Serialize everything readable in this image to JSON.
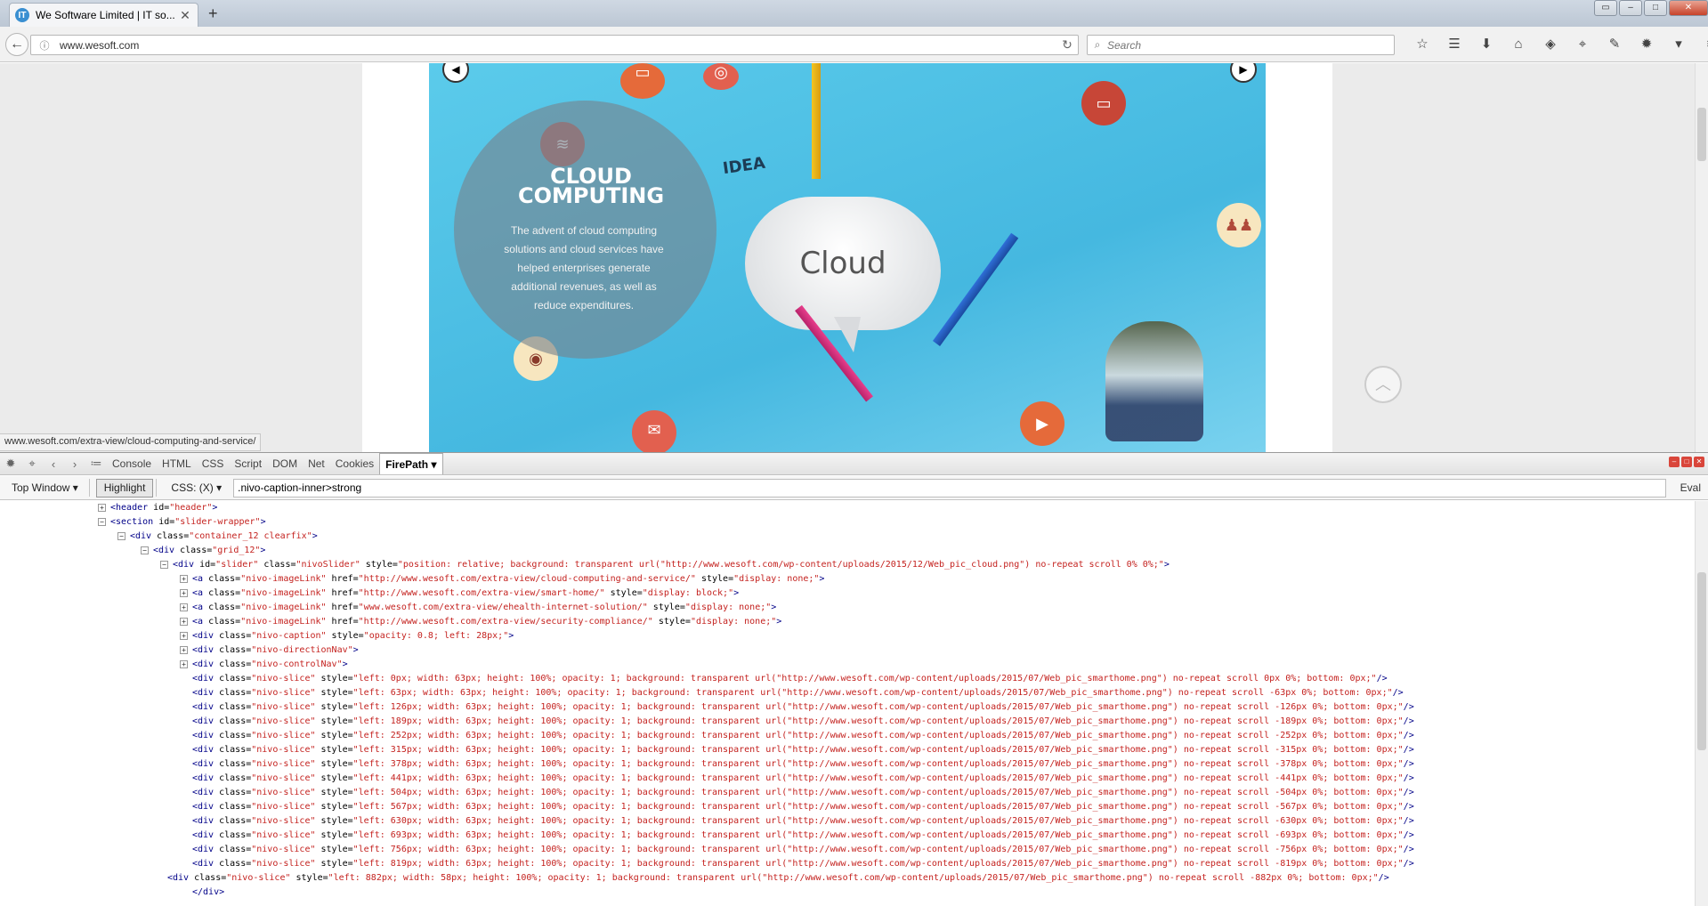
{
  "browser": {
    "tab_title": "We Software Limited | IT so...",
    "tab_favicon": "IT",
    "url": "www.wesoft.com",
    "search_placeholder": "Search",
    "status_url": "www.wesoft.com/extra-view/cloud-computing-and-service/"
  },
  "slide": {
    "caption_title": "CLOUD COMPUTING",
    "caption_text": "The advent of cloud computing solutions and cloud services have helped enterprises generate additional revenues, as well as reduce expenditures.",
    "cloud_word": "Cloud",
    "idea_word": "IDEA",
    "sky_color": "#45b8e0"
  },
  "firebug": {
    "tabs": [
      "Console",
      "HTML",
      "CSS",
      "Script",
      "DOM",
      "Net",
      "Cookies",
      "FirePath ▾"
    ],
    "active_tab": "FirePath",
    "window_select": "Top Window ▾",
    "highlight_label": "Highlight",
    "css_mode": "CSS: (X) ▾",
    "xpath_value": ".nivo-caption-inner>strong",
    "eval_label": "Eval",
    "code_lines": [
      {
        "t": "+",
        "p": [
          [
            "tg",
            "<header "
          ],
          [
            "an",
            "id="
          ],
          [
            "av",
            "\"header\""
          ],
          [
            "tg",
            ">"
          ]
        ]
      },
      {
        "t": "-",
        "p": [
          [
            "tg",
            "<section "
          ],
          [
            "an",
            "id="
          ],
          [
            "av",
            "\"slider-wrapper\""
          ],
          [
            "tg",
            ">"
          ]
        ]
      },
      {
        "t": "-",
        "p": [
          [
            "tg",
            "<div "
          ],
          [
            "an",
            "class="
          ],
          [
            "av",
            "\"container_12 clearfix\""
          ],
          [
            "tg",
            ">"
          ]
        ]
      },
      {
        "t": "-",
        "p": [
          [
            "tg",
            "<div "
          ],
          [
            "an",
            "class="
          ],
          [
            "av",
            "\"grid_12\""
          ],
          [
            "tg",
            ">"
          ]
        ]
      },
      {
        "t": "-",
        "p": [
          [
            "tg",
            "<div "
          ],
          [
            "an",
            "id="
          ],
          [
            "av",
            "\"slider\" "
          ],
          [
            "an",
            "class="
          ],
          [
            "av",
            "\"nivoSlider\" "
          ],
          [
            "an",
            "style="
          ],
          [
            "av",
            "\"position: relative; background: transparent url(\"http://www.wesoft.com/wp-content/uploads/2015/12/Web_pic_cloud.png\") no-repeat scroll 0% 0%;\""
          ],
          [
            "tg",
            ">"
          ]
        ]
      },
      {
        "t": "+",
        "p": [
          [
            "tg",
            "<a "
          ],
          [
            "an",
            "class="
          ],
          [
            "av",
            "\"nivo-imageLink\" "
          ],
          [
            "an",
            "href="
          ],
          [
            "av",
            "\"http://www.wesoft.com/extra-view/cloud-computing-and-service/\" "
          ],
          [
            "an",
            "style="
          ],
          [
            "av",
            "\"display: none;\""
          ],
          [
            "tg",
            ">"
          ]
        ]
      },
      {
        "t": "+",
        "p": [
          [
            "tg",
            "<a "
          ],
          [
            "an",
            "class="
          ],
          [
            "av",
            "\"nivo-imageLink\" "
          ],
          [
            "an",
            "href="
          ],
          [
            "av",
            "\"http://www.wesoft.com/extra-view/smart-home/\" "
          ],
          [
            "an",
            "style="
          ],
          [
            "av",
            "\"display: block;\""
          ],
          [
            "tg",
            ">"
          ]
        ]
      },
      {
        "t": "+",
        "p": [
          [
            "tg",
            "<a "
          ],
          [
            "an",
            "class="
          ],
          [
            "av",
            "\"nivo-imageLink\" "
          ],
          [
            "an",
            "href="
          ],
          [
            "av",
            "\"www.wesoft.com/extra-view/ehealth-internet-solution/\" "
          ],
          [
            "an",
            "style="
          ],
          [
            "av",
            "\"display: none;\""
          ],
          [
            "tg",
            ">"
          ]
        ]
      },
      {
        "t": "+",
        "p": [
          [
            "tg",
            "<a "
          ],
          [
            "an",
            "class="
          ],
          [
            "av",
            "\"nivo-imageLink\" "
          ],
          [
            "an",
            "href="
          ],
          [
            "av",
            "\"http://www.wesoft.com/extra-view/security-compliance/\" "
          ],
          [
            "an",
            "style="
          ],
          [
            "av",
            "\"display: none;\""
          ],
          [
            "tg",
            ">"
          ]
        ]
      },
      {
        "t": "+",
        "p": [
          [
            "tg",
            "<div "
          ],
          [
            "an",
            "class="
          ],
          [
            "av",
            "\"nivo-caption\" "
          ],
          [
            "an",
            "style="
          ],
          [
            "av",
            "\"opacity: 0.8; left: 28px;\""
          ],
          [
            "tg",
            ">"
          ]
        ]
      },
      {
        "t": "+",
        "p": [
          [
            "tg",
            "<div "
          ],
          [
            "an",
            "class="
          ],
          [
            "av",
            "\"nivo-directionNav\""
          ],
          [
            "tg",
            ">"
          ]
        ]
      },
      {
        "t": "+",
        "p": [
          [
            "tg",
            "<div "
          ],
          [
            "an",
            "class="
          ],
          [
            "av",
            "\"nivo-controlNav\""
          ],
          [
            "tg",
            ">"
          ]
        ]
      },
      {
        "t": "",
        "p": [
          [
            "tg",
            "<div "
          ],
          [
            "an",
            "class="
          ],
          [
            "av",
            "\"nivo-slice\" "
          ],
          [
            "an",
            "style="
          ],
          [
            "av",
            "\"left: 0px; width: 63px; height: 100%; opacity: 1; background: transparent url(\"http://www.wesoft.com/wp-content/uploads/2015/07/Web_pic_smarthome.png\") no-repeat scroll 0px 0%; bottom: 0px;\""
          ],
          [
            "tg",
            "/>"
          ]
        ]
      },
      {
        "t": "",
        "p": [
          [
            "tg",
            "<div "
          ],
          [
            "an",
            "class="
          ],
          [
            "av",
            "\"nivo-slice\" "
          ],
          [
            "an",
            "style="
          ],
          [
            "av",
            "\"left: 63px; width: 63px; height: 100%; opacity: 1; background: transparent url(\"http://www.wesoft.com/wp-content/uploads/2015/07/Web_pic_smarthome.png\") no-repeat scroll -63px 0%; bottom: 0px;\""
          ],
          [
            "tg",
            "/>"
          ]
        ]
      },
      {
        "t": "",
        "p": [
          [
            "tg",
            "<div "
          ],
          [
            "an",
            "class="
          ],
          [
            "av",
            "\"nivo-slice\" "
          ],
          [
            "an",
            "style="
          ],
          [
            "av",
            "\"left: 126px; width: 63px; height: 100%; opacity: 1; background: transparent url(\"http://www.wesoft.com/wp-content/uploads/2015/07/Web_pic_smarthome.png\") no-repeat scroll -126px 0%; bottom: 0px;\""
          ],
          [
            "tg",
            "/>"
          ]
        ]
      },
      {
        "t": "",
        "p": [
          [
            "tg",
            "<div "
          ],
          [
            "an",
            "class="
          ],
          [
            "av",
            "\"nivo-slice\" "
          ],
          [
            "an",
            "style="
          ],
          [
            "av",
            "\"left: 189px; width: 63px; height: 100%; opacity: 1; background: transparent url(\"http://www.wesoft.com/wp-content/uploads/2015/07/Web_pic_smarthome.png\") no-repeat scroll -189px 0%; bottom: 0px;\""
          ],
          [
            "tg",
            "/>"
          ]
        ]
      },
      {
        "t": "",
        "p": [
          [
            "tg",
            "<div "
          ],
          [
            "an",
            "class="
          ],
          [
            "av",
            "\"nivo-slice\" "
          ],
          [
            "an",
            "style="
          ],
          [
            "av",
            "\"left: 252px; width: 63px; height: 100%; opacity: 1; background: transparent url(\"http://www.wesoft.com/wp-content/uploads/2015/07/Web_pic_smarthome.png\") no-repeat scroll -252px 0%; bottom: 0px;\""
          ],
          [
            "tg",
            "/>"
          ]
        ]
      },
      {
        "t": "",
        "p": [
          [
            "tg",
            "<div "
          ],
          [
            "an",
            "class="
          ],
          [
            "av",
            "\"nivo-slice\" "
          ],
          [
            "an",
            "style="
          ],
          [
            "av",
            "\"left: 315px; width: 63px; height: 100%; opacity: 1; background: transparent url(\"http://www.wesoft.com/wp-content/uploads/2015/07/Web_pic_smarthome.png\") no-repeat scroll -315px 0%; bottom: 0px;\""
          ],
          [
            "tg",
            "/>"
          ]
        ]
      },
      {
        "t": "",
        "p": [
          [
            "tg",
            "<div "
          ],
          [
            "an",
            "class="
          ],
          [
            "av",
            "\"nivo-slice\" "
          ],
          [
            "an",
            "style="
          ],
          [
            "av",
            "\"left: 378px; width: 63px; height: 100%; opacity: 1; background: transparent url(\"http://www.wesoft.com/wp-content/uploads/2015/07/Web_pic_smarthome.png\") no-repeat scroll -378px 0%; bottom: 0px;\""
          ],
          [
            "tg",
            "/>"
          ]
        ]
      },
      {
        "t": "",
        "p": [
          [
            "tg",
            "<div "
          ],
          [
            "an",
            "class="
          ],
          [
            "av",
            "\"nivo-slice\" "
          ],
          [
            "an",
            "style="
          ],
          [
            "av",
            "\"left: 441px; width: 63px; height: 100%; opacity: 1; background: transparent url(\"http://www.wesoft.com/wp-content/uploads/2015/07/Web_pic_smarthome.png\") no-repeat scroll -441px 0%; bottom: 0px;\""
          ],
          [
            "tg",
            "/>"
          ]
        ]
      },
      {
        "t": "",
        "p": [
          [
            "tg",
            "<div "
          ],
          [
            "an",
            "class="
          ],
          [
            "av",
            "\"nivo-slice\" "
          ],
          [
            "an",
            "style="
          ],
          [
            "av",
            "\"left: 504px; width: 63px; height: 100%; opacity: 1; background: transparent url(\"http://www.wesoft.com/wp-content/uploads/2015/07/Web_pic_smarthome.png\") no-repeat scroll -504px 0%; bottom: 0px;\""
          ],
          [
            "tg",
            "/>"
          ]
        ]
      },
      {
        "t": "",
        "p": [
          [
            "tg",
            "<div "
          ],
          [
            "an",
            "class="
          ],
          [
            "av",
            "\"nivo-slice\" "
          ],
          [
            "an",
            "style="
          ],
          [
            "av",
            "\"left: 567px; width: 63px; height: 100%; opacity: 1; background: transparent url(\"http://www.wesoft.com/wp-content/uploads/2015/07/Web_pic_smarthome.png\") no-repeat scroll -567px 0%; bottom: 0px;\""
          ],
          [
            "tg",
            "/>"
          ]
        ]
      },
      {
        "t": "",
        "p": [
          [
            "tg",
            "<div "
          ],
          [
            "an",
            "class="
          ],
          [
            "av",
            "\"nivo-slice\" "
          ],
          [
            "an",
            "style="
          ],
          [
            "av",
            "\"left: 630px; width: 63px; height: 100%; opacity: 1; background: transparent url(\"http://www.wesoft.com/wp-content/uploads/2015/07/Web_pic_smarthome.png\") no-repeat scroll -630px 0%; bottom: 0px;\""
          ],
          [
            "tg",
            "/>"
          ]
        ]
      },
      {
        "t": "",
        "p": [
          [
            "tg",
            "<div "
          ],
          [
            "an",
            "class="
          ],
          [
            "av",
            "\"nivo-slice\" "
          ],
          [
            "an",
            "style="
          ],
          [
            "av",
            "\"left: 693px; width: 63px; height: 100%; opacity: 1; background: transparent url(\"http://www.wesoft.com/wp-content/uploads/2015/07/Web_pic_smarthome.png\") no-repeat scroll -693px 0%; bottom: 0px;\""
          ],
          [
            "tg",
            "/>"
          ]
        ]
      },
      {
        "t": "",
        "p": [
          [
            "tg",
            "<div "
          ],
          [
            "an",
            "class="
          ],
          [
            "av",
            "\"nivo-slice\" "
          ],
          [
            "an",
            "style="
          ],
          [
            "av",
            "\"left: 756px; width: 63px; height: 100%; opacity: 1; background: transparent url(\"http://www.wesoft.com/wp-content/uploads/2015/07/Web_pic_smarthome.png\") no-repeat scroll -756px 0%; bottom: 0px;\""
          ],
          [
            "tg",
            "/>"
          ]
        ]
      },
      {
        "t": "",
        "p": [
          [
            "tg",
            "<div "
          ],
          [
            "an",
            "class="
          ],
          [
            "av",
            "\"nivo-slice\" "
          ],
          [
            "an",
            "style="
          ],
          [
            "av",
            "\"left: 819px; width: 63px; height: 100%; opacity: 1; background: transparent url(\"http://www.wesoft.com/wp-content/uploads/2015/07/Web_pic_smarthome.png\") no-repeat scroll -819px 0%; bottom: 0px;\""
          ],
          [
            "tg",
            "/>"
          ]
        ]
      },
      {
        "t": "",
        "p": [
          [
            "tg",
            "<div "
          ],
          [
            "an",
            "class="
          ],
          [
            "av",
            "\"nivo-slice\" "
          ],
          [
            "an",
            "style="
          ],
          [
            "av",
            "\"left: 882px; width: 58px; height: 100%; opacity: 1; background: transparent url(\"http://www.wesoft.com/wp-content/uploads/2015/07/Web_pic_smarthome.png\") no-repeat scroll -882px 0%; bottom: 0px;\""
          ],
          [
            "tg",
            "/>"
          ]
        ]
      },
      {
        "t": "",
        "p": [
          [
            "tg",
            "</div>"
          ]
        ]
      }
    ]
  }
}
